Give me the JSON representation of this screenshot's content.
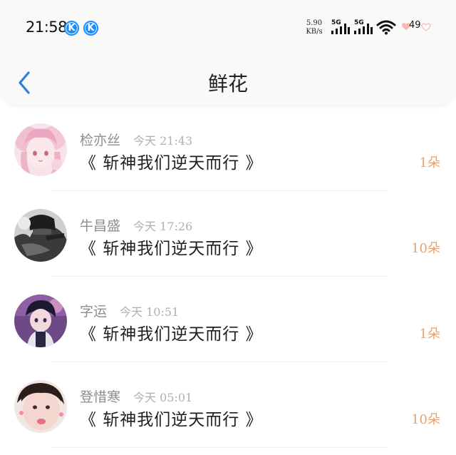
{
  "status_bar": {
    "time": "21:58",
    "app_badges": [
      "K",
      "K"
    ],
    "speed_value": "5.90",
    "speed_unit": "KB/s",
    "sim1_label": "5G",
    "sim2_label": "5G",
    "battery": "49"
  },
  "header": {
    "title": "鲜花",
    "back_icon": "chevron-left-icon"
  },
  "colors": {
    "accent_back": "#2e7fd8",
    "flower_count": "#e0a374"
  },
  "items": [
    {
      "name": "检亦丝",
      "time": "今天 21:43",
      "book": "《 斩神我们逆天而行 》",
      "count": "1朵"
    },
    {
      "name": "牛昌盛",
      "time": "今天 17:26",
      "book": "《 斩神我们逆天而行 》",
      "count": "10朵"
    },
    {
      "name": "字运",
      "time": "今天 10:51",
      "book": "《 斩神我们逆天而行 》",
      "count": "1朵"
    },
    {
      "name": "登惜寒",
      "time": "今天 05:01",
      "book": "《 斩神我们逆天而行 》",
      "count": "10朵"
    }
  ]
}
